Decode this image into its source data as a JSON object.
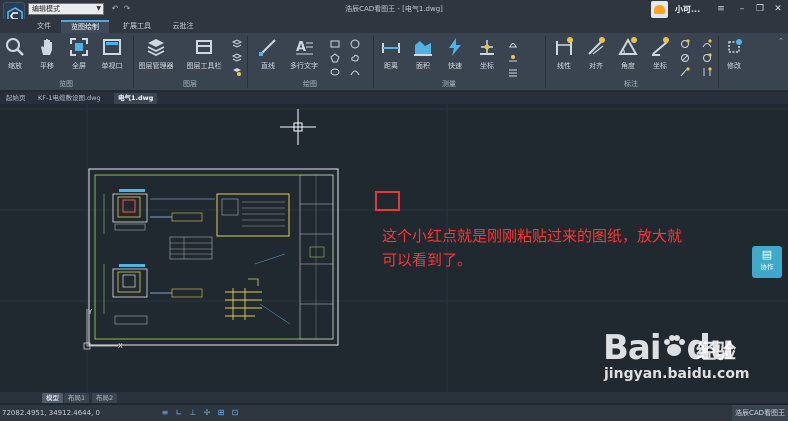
{
  "titlebar": {
    "mode_select": "编辑模式",
    "window_title": "浩辰CAD看图王 - [电气1.dwg]",
    "user_name": "小可..."
  },
  "ribbon_tabs": [
    "文件",
    "览图绘制",
    "扩展工具",
    "云批注"
  ],
  "ribbon": {
    "tools": {
      "zoom": "缩放",
      "pan": "平移",
      "fullscreen": "全屏",
      "single_viewport": "单视口",
      "layer_manager": "图层管理器",
      "layer_toolbar": "图层工具栏",
      "line": "直线",
      "mtext": "多行文字",
      "distance": "距离",
      "area": "面积",
      "quick": "快速",
      "coordinate": "坐标",
      "linear": "线性",
      "aligned": "对齐",
      "angle": "角度",
      "coord_dim": "坐标",
      "modify": "修改"
    },
    "groups": {
      "view": "览图",
      "layers": "图层",
      "draw": "绘图",
      "measure": "测量",
      "annotate": "标注"
    }
  },
  "doc_tabs": [
    "起始页",
    "KF-1电缆敷设图.dwg",
    "电气1.dwg"
  ],
  "annotation": {
    "line1": "这个小红点就是刚刚粘贴过来的图纸，放大就",
    "line2": "可以看到了。"
  },
  "collab_button": "协作",
  "watermark": {
    "logo_left": "Bai",
    "logo_right": "du",
    "brand": "经验",
    "url": "jingyan.baidu.com"
  },
  "layout_tabs": [
    "模型",
    "布局1",
    "布局2"
  ],
  "status": {
    "coordinates": "72082.4951, 34912.4644, 0",
    "app_name": "浩辰CAD看图王"
  },
  "colors": {
    "accent": "#49a6e9",
    "annotation_red": "#ff3333",
    "canvas": "#202830"
  }
}
